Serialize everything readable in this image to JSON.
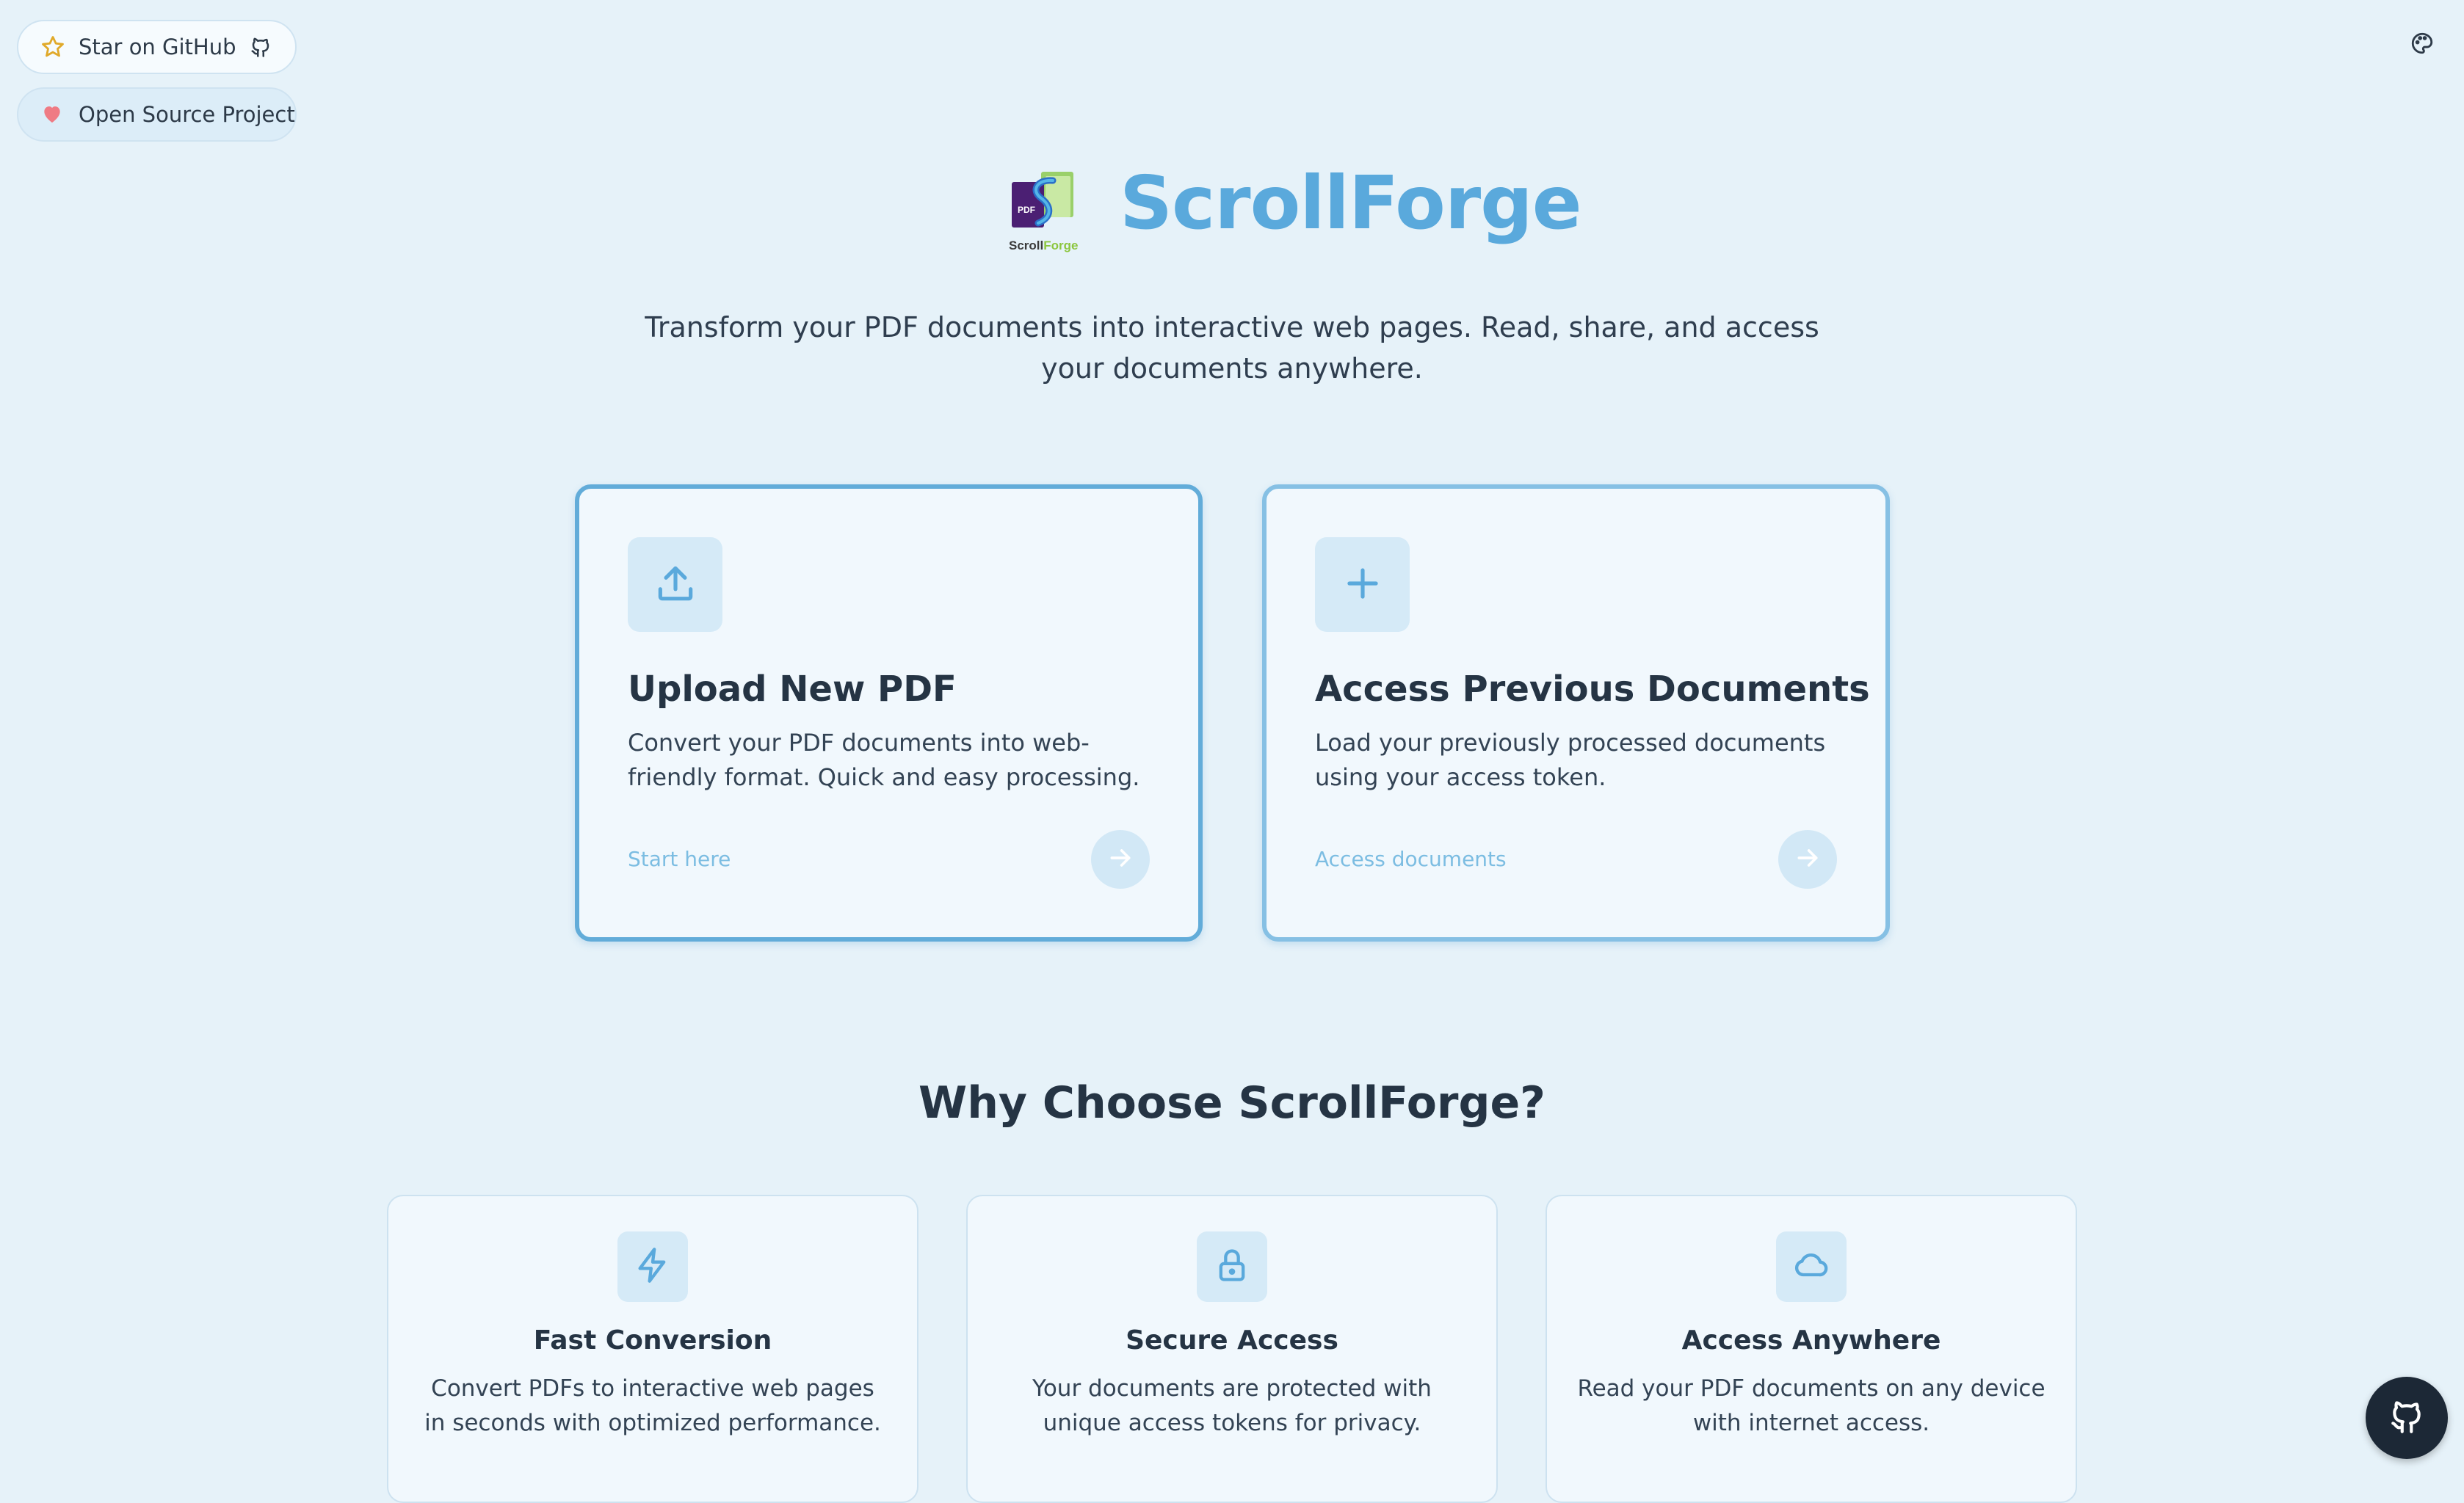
{
  "top_links": {
    "github_label": "Star on GitHub",
    "oss_label": "Open Source Project"
  },
  "hero": {
    "title": "ScrollForge",
    "logo_badge": "PDF",
    "logo_word_a": "Scroll",
    "logo_word_b": "Forge",
    "subtitle": "Transform your PDF documents into interactive web pages. Read, share, and access your documents anywhere."
  },
  "cards": {
    "upload": {
      "title": "Upload New PDF",
      "description": "Convert your PDF documents into web-friendly format. Quick and easy processing.",
      "link": "Start here"
    },
    "access": {
      "title": "Access Previous Documents",
      "description": "Load your previously processed documents using your access token.",
      "link": "Access documents"
    }
  },
  "why": {
    "title": "Why Choose ScrollForge?",
    "features": [
      {
        "title": "Fast Conversion",
        "description": "Convert PDFs to interactive web pages in seconds with optimized performance.",
        "icon": "lightning-icon"
      },
      {
        "title": "Secure Access",
        "description": "Your documents are protected with unique access tokens for privacy.",
        "icon": "lock-icon"
      },
      {
        "title": "Access Anywhere",
        "description": "Read your PDF documents on any device with internet access.",
        "icon": "cloud-icon"
      }
    ]
  },
  "colors": {
    "accent": "#5aa9dc",
    "background": "#e6f2f9",
    "heading": "#253444",
    "fab": "#1c2836"
  }
}
